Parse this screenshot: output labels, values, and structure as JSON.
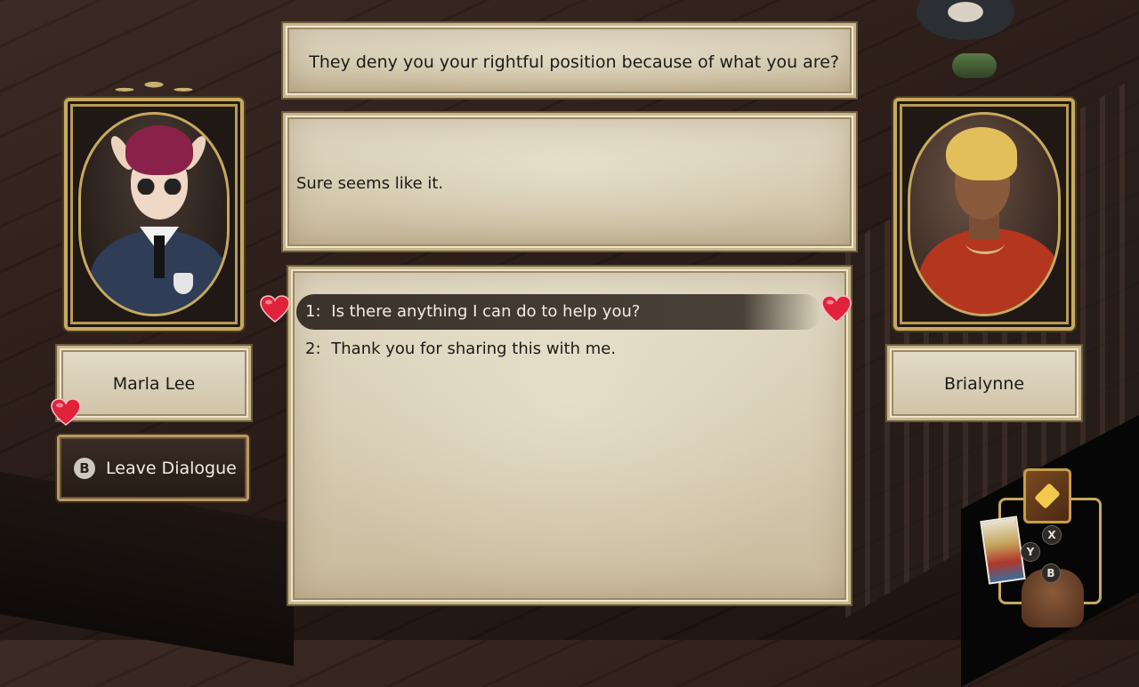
{
  "dialogue": {
    "prompt": "They deny you your rightful position because of what you are?",
    "reply": "Sure seems like it."
  },
  "choices": [
    {
      "number": "1:",
      "text": "Is there anything I can do to help you?",
      "selected": true
    },
    {
      "number": "2:",
      "text": "Thank you for sharing this with me.",
      "selected": false
    }
  ],
  "characters": {
    "left": {
      "name": "Marla Lee"
    },
    "right": {
      "name": "Brialynne"
    }
  },
  "leave": {
    "button_glyph": "B",
    "label": "Leave Dialogue"
  },
  "quick_menu": {
    "x_label": "X",
    "y_label": "Y",
    "b_label": "B",
    "icons": [
      "journal-book-icon",
      "tarot-cards-icon",
      "backpack-icon"
    ]
  },
  "colors": {
    "heart": "#e0223a",
    "frame_gold": "#c6a95f",
    "parchment": "#d3c8ae"
  }
}
